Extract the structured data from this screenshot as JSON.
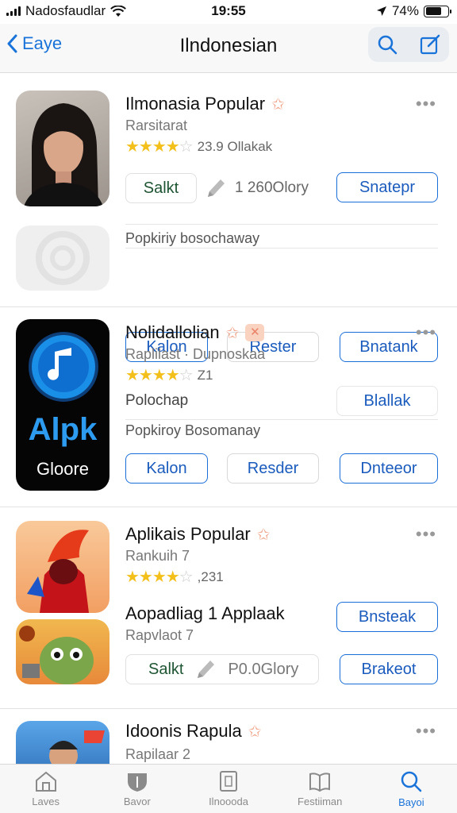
{
  "status": {
    "carrier": "Nadosfaudlar",
    "time": "19:55",
    "battery": "74%"
  },
  "nav": {
    "back_label": "Eaye",
    "title": "Ilndonesian"
  },
  "apps": [
    {
      "title": "Ilmonasia Popular",
      "subtitle": "Rarsitarat",
      "rating_text": "23.9 Ollakak",
      "pill_label": "Salkt",
      "pill_count": "1 260Olory",
      "button": "Snatepr"
    },
    {
      "subtitle": "Popkiriy bosochaway",
      "button_left": "Kalon",
      "button_mid": "Rester",
      "button_right": "Bnatank"
    },
    {
      "title": "Nolidallolian",
      "subtitle": "Raplilast · Dupnoskaa",
      "rating_text": "Z1",
      "icon_text_top": "Alpk",
      "icon_text_bottom": "Gloore",
      "line1": "Polochap",
      "line1_action": "Blallak",
      "line2": "Popkiroy Bosomanay",
      "button_left": "Kalon",
      "button_mid": "Resder",
      "button_right": "Dnteeor"
    },
    {
      "title": "Aplikais Popular",
      "subtitle": "Rankuih 7",
      "rating_text": ",231",
      "button_top": "Bnsteak",
      "title2": "Aopadliag 1 Applaak",
      "subtitle2": "Rapvlaot 7",
      "pill_label": "Salkt",
      "pill_count": "P0.0Glory",
      "button_bottom": "Brakeot"
    },
    {
      "title": "Idoonis Rapula",
      "subtitle": "Rapilaar 2"
    }
  ],
  "tabs": [
    {
      "label": "Laves"
    },
    {
      "label": "Bavor"
    },
    {
      "label": "Ilnoooda"
    },
    {
      "label": "Festiiman"
    },
    {
      "label": "Bayoi"
    }
  ],
  "colors": {
    "accent": "#1a73d9",
    "star": "#f3c01b",
    "favorite": "#f0a288"
  }
}
